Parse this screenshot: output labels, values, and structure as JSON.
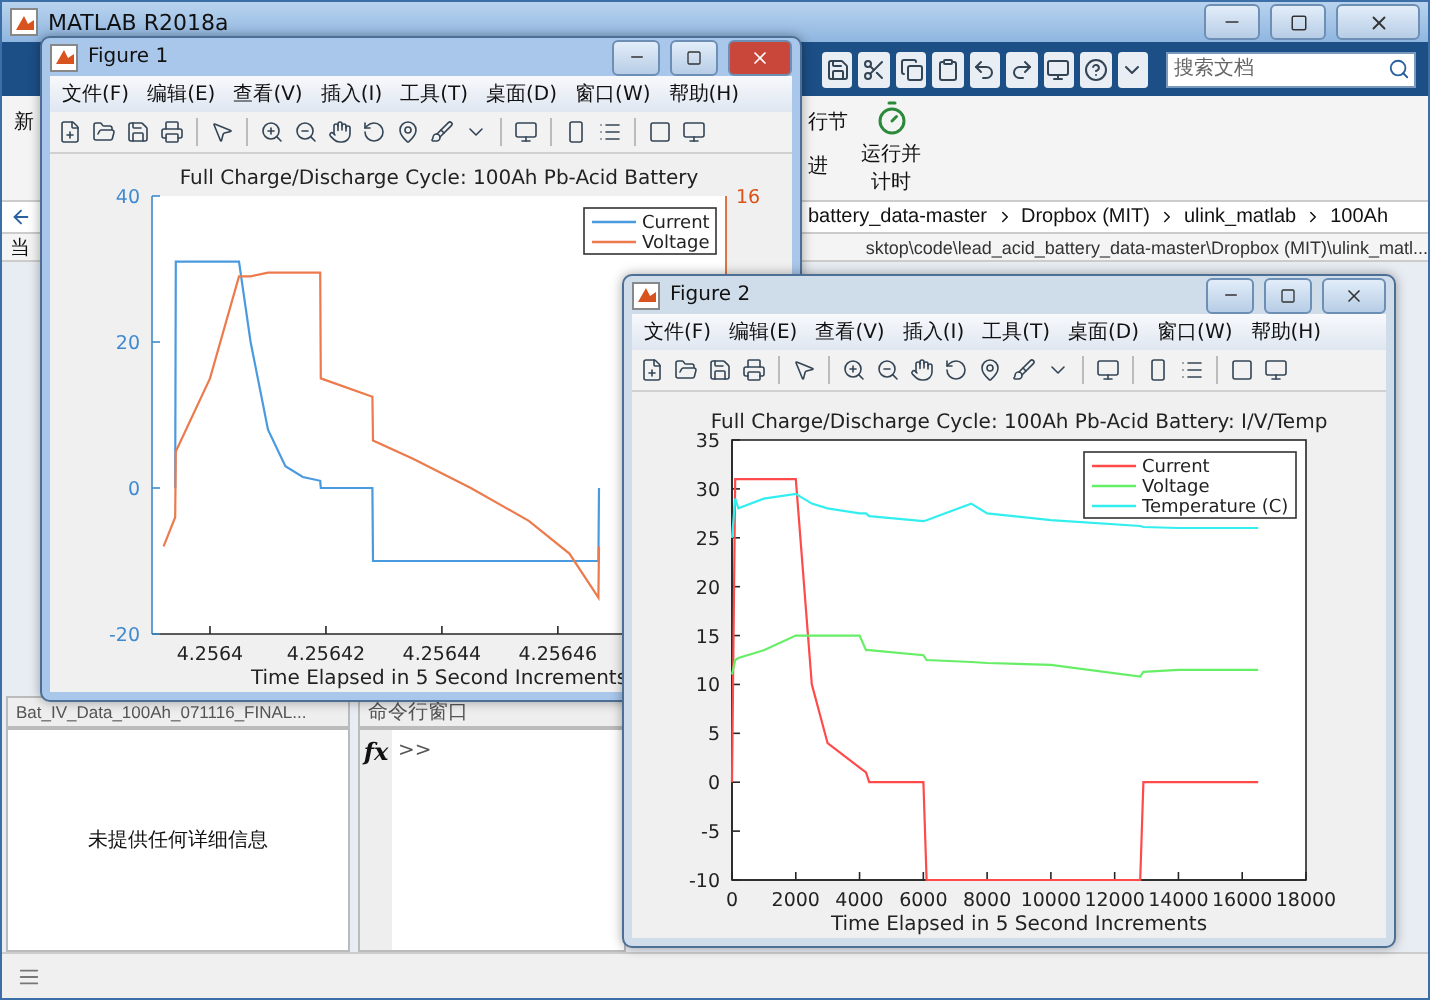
{
  "main_window": {
    "title": "MATLAB R2018a",
    "search": {
      "placeholder": "搜索文档"
    },
    "ribbon": [
      {
        "label": "新"
      },
      {
        "label": "行节"
      },
      {
        "label": "进"
      },
      {
        "label": "运行并计时"
      }
    ],
    "breadcrumbs": [
      "battery_data-master",
      "Dropbox (MIT)",
      "ulink_matlab",
      "100Ah"
    ],
    "path_label": "当",
    "path": "sktop\\code\\lead_acid_battery_data-master\\Dropbox (MIT)\\ulink_matl...",
    "file_header": "Bat_IV_Data_100Ah_071116_FINAL...",
    "details_text": "未提供任何详细信息",
    "command_window": {
      "title": "命令行窗口",
      "function_button": "fx",
      "prompt": ">>"
    }
  },
  "figures": [
    {
      "title": "Figure 1",
      "active": true,
      "menu": [
        "文件(F)",
        "编辑(E)",
        "查看(V)",
        "插入(I)",
        "工具(T)",
        "桌面(D)",
        "窗口(W)",
        "帮助(H)"
      ],
      "chart_data": {
        "type": "line",
        "title": "Full Charge/Discharge Cycle: 100Ah Pb-Acid Battery",
        "xlabel": "Time Elapsed in 5 Second Increments",
        "x": [
          4.256392,
          4.256394,
          4.2563941,
          4.2564,
          4.256405,
          4.256407,
          4.25641,
          4.256413,
          4.256416,
          4.256419,
          4.2564191,
          4.256428,
          4.2564281,
          4.256435,
          4.256445,
          4.256455,
          4.256462,
          4.256467,
          4.2564671
        ],
        "series": [
          {
            "name": "Current",
            "color": "#4a9ae0",
            "values": [
              null,
              0,
              31,
              31,
              31,
              20,
              8,
              3,
              1.5,
              1,
              0,
              0,
              -10,
              -10,
              -10,
              -10,
              -10,
              -10,
              0
            ]
          },
          {
            "name": "Voltage",
            "color": "#ec7a4c",
            "values": [
              -8,
              -4,
              5,
              15,
              29,
              29,
              29.5,
              29.5,
              29.5,
              29.5,
              15,
              12.5,
              6.5,
              4,
              0,
              -4.5,
              -9,
              -15,
              -8
            ]
          }
        ],
        "xlim": [
          4.25639,
          4.256489
        ],
        "ylim": [
          -20,
          40
        ],
        "xticks": [
          4.2564,
          4.25642,
          4.25644,
          4.25646
        ],
        "yticks": [
          -20,
          0,
          20,
          40
        ],
        "annotations": [
          {
            "text": "16"
          }
        ],
        "legend": true
      }
    },
    {
      "title": "Figure 2",
      "active": false,
      "menu": [
        "文件(F)",
        "编辑(E)",
        "查看(V)",
        "插入(I)",
        "工具(T)",
        "桌面(D)",
        "窗口(W)",
        "帮助(H)"
      ],
      "chart_data": {
        "type": "line",
        "title": "Full Charge/Discharge Cycle: 100Ah Pb-Acid Battery: I/V/Temp",
        "xlabel": "Time Elapsed in 5 Second Increments",
        "x": [
          0,
          100,
          200,
          1000,
          2000,
          2500,
          3000,
          4000,
          4200,
          4300,
          6000,
          6100,
          7500,
          8000,
          10000,
          12800,
          12900,
          14000,
          16500
        ],
        "series": [
          {
            "name": "Current",
            "color": "#ff4a4a",
            "values": [
              0,
              31,
              31,
              31,
              31,
              10,
              4,
              1.5,
              1,
              0,
              0,
              -10,
              -10,
              -10,
              -10,
              -10,
              0,
              0,
              0
            ]
          },
          {
            "name": "Voltage",
            "color": "#66ee66",
            "values": [
              11,
              12.5,
              12.7,
              13.5,
              15,
              15,
              15,
              15,
              13.5,
              13.5,
              13,
              12.5,
              12.3,
              12.2,
              12,
              10.8,
              11.3,
              11.5,
              11.5
            ]
          },
          {
            "name": "Temperature (C)",
            "color": "#33eeee",
            "values": [
              25,
              29,
              28,
              29,
              29.5,
              28.5,
              28,
              27.5,
              27.5,
              27.2,
              26.7,
              26.8,
              28.5,
              27.5,
              26.8,
              26.2,
              26.1,
              26,
              26
            ]
          }
        ],
        "xlim": [
          0,
          18000
        ],
        "ylim": [
          -10,
          35
        ],
        "xticks": [
          0,
          2000,
          4000,
          6000,
          8000,
          10000,
          12000,
          14000,
          16000,
          18000
        ],
        "yticks": [
          -10,
          -5,
          0,
          5,
          10,
          15,
          20,
          25,
          30,
          35
        ],
        "legend": true
      }
    }
  ]
}
